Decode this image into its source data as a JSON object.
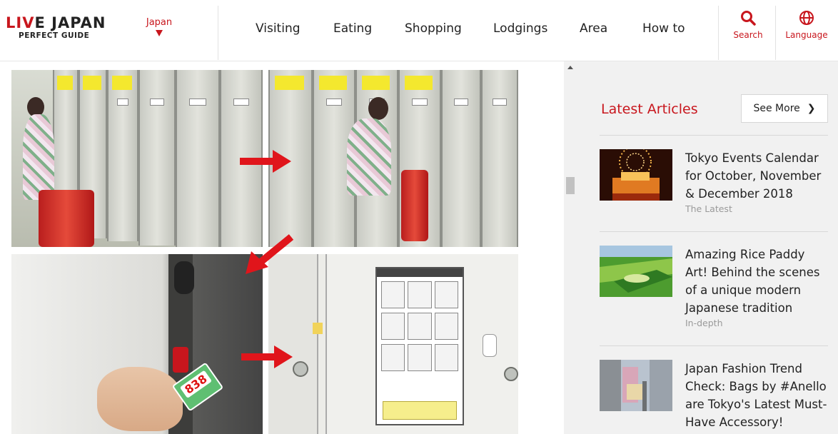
{
  "header": {
    "logo_main_first": "LI",
    "logo_main_v": "V",
    "logo_main_rest": "E JAPAN",
    "logo_sub": "PERFECT GUIDE",
    "region": "Japan",
    "nav": [
      "Visiting",
      "Eating",
      "Shopping",
      "Lodgings",
      "Area",
      "How to"
    ],
    "search_label": "Search",
    "language_label": "Language",
    "accent_color": "#c8161d"
  },
  "main": {
    "image_tag_number": "838"
  },
  "sidebar": {
    "title": "Latest Articles",
    "see_more": "See More",
    "articles": [
      {
        "title": "Tokyo Events Calendar for October, November & December 2018",
        "category": "The Latest",
        "thumb": "fireworks-festival"
      },
      {
        "title": "Amazing Rice Paddy Art! Behind the scenes of a unique modern Japanese tradition",
        "category": "In-depth",
        "thumb": "rice-paddy-field"
      },
      {
        "title": "Japan Fashion Trend Check: Bags by #Anello are Tokyo's Latest Must-Have Accessory!",
        "category": "",
        "thumb": "street-with-bag"
      }
    ]
  }
}
